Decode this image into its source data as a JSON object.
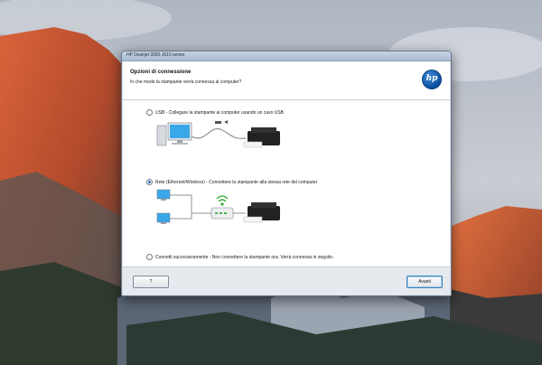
{
  "window": {
    "title": "HP Deskjet 3050 J610 series"
  },
  "header": {
    "title": "Opzioni di connessione",
    "subtitle": "In che modo la stampante verrà connessa al computer?",
    "logo_text": "hp"
  },
  "options": [
    {
      "label": "USB - Collegare la stampante al computer usando un cavo USB",
      "selected": false
    },
    {
      "label": "Rete (Ethernet/Wireless) - Connettere la stampante alla stessa rete del computer",
      "selected": true
    },
    {
      "label": "Connetti successivamente - Non connettere la stampante ora. Verrà connessa in seguito.",
      "selected": false
    }
  ],
  "footer": {
    "help_label": "?",
    "next_label": "Avanti"
  },
  "colors": {
    "accent": "#2a6fbf",
    "hp_blue": "#0b4f9e",
    "titlebar": "#b9c9db"
  },
  "icons": [
    "hp-logo-icon",
    "computer-icon",
    "usb-cable-icon",
    "printer-icon",
    "router-icon",
    "wifi-icon"
  ]
}
